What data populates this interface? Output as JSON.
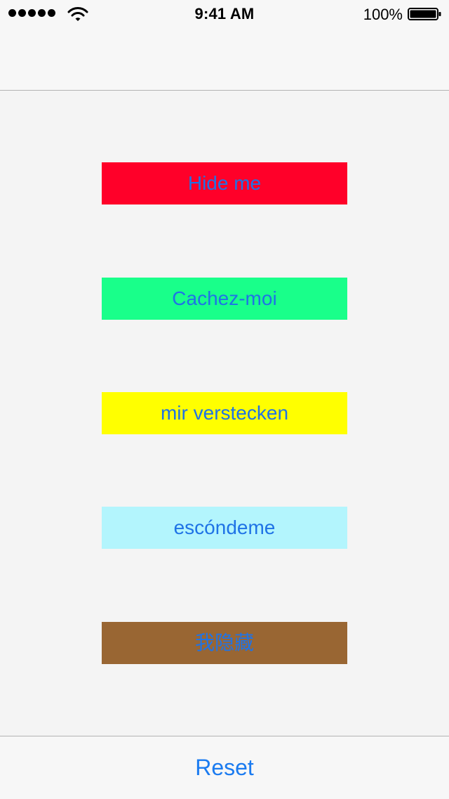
{
  "status_bar": {
    "time": "9:41 AM",
    "battery_percent": "100%",
    "signal_bars_filled": 5,
    "wifi_icon": "wifi-icon",
    "battery_icon": "battery-full-icon"
  },
  "buttons": [
    {
      "label": "Hide me",
      "background": "#ff0029"
    },
    {
      "label": "Cachez-moi",
      "background": "#19ff8a"
    },
    {
      "label": "mir verstecken",
      "background": "#ffff00"
    },
    {
      "label": "escóndeme",
      "background": "#b3f5fd"
    },
    {
      "label": "我隐藏",
      "background": "#996633"
    }
  ],
  "toolbar": {
    "reset_label": "Reset"
  },
  "colors": {
    "tint": "#1f73e6",
    "bars": "#f7f7f7",
    "background": "#f4f4f4",
    "separator": "#b2b2b2"
  }
}
